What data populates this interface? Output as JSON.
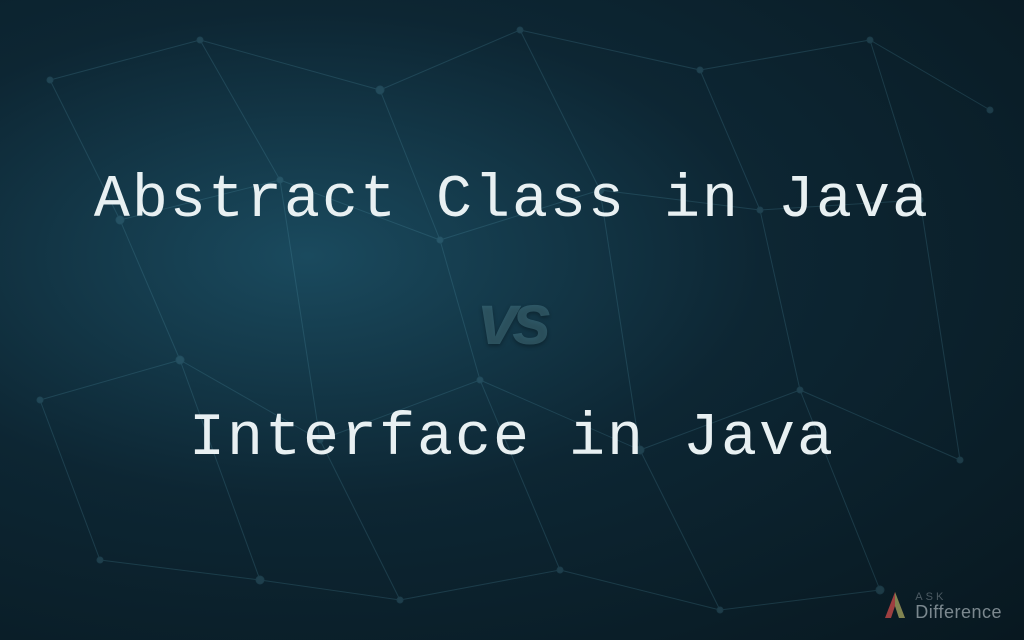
{
  "comparison": {
    "top_title": "Abstract Class in Java",
    "vs_label": "vs",
    "bottom_title": "Interface in Java"
  },
  "brand": {
    "line1": "ASK",
    "line2": "Difference"
  }
}
